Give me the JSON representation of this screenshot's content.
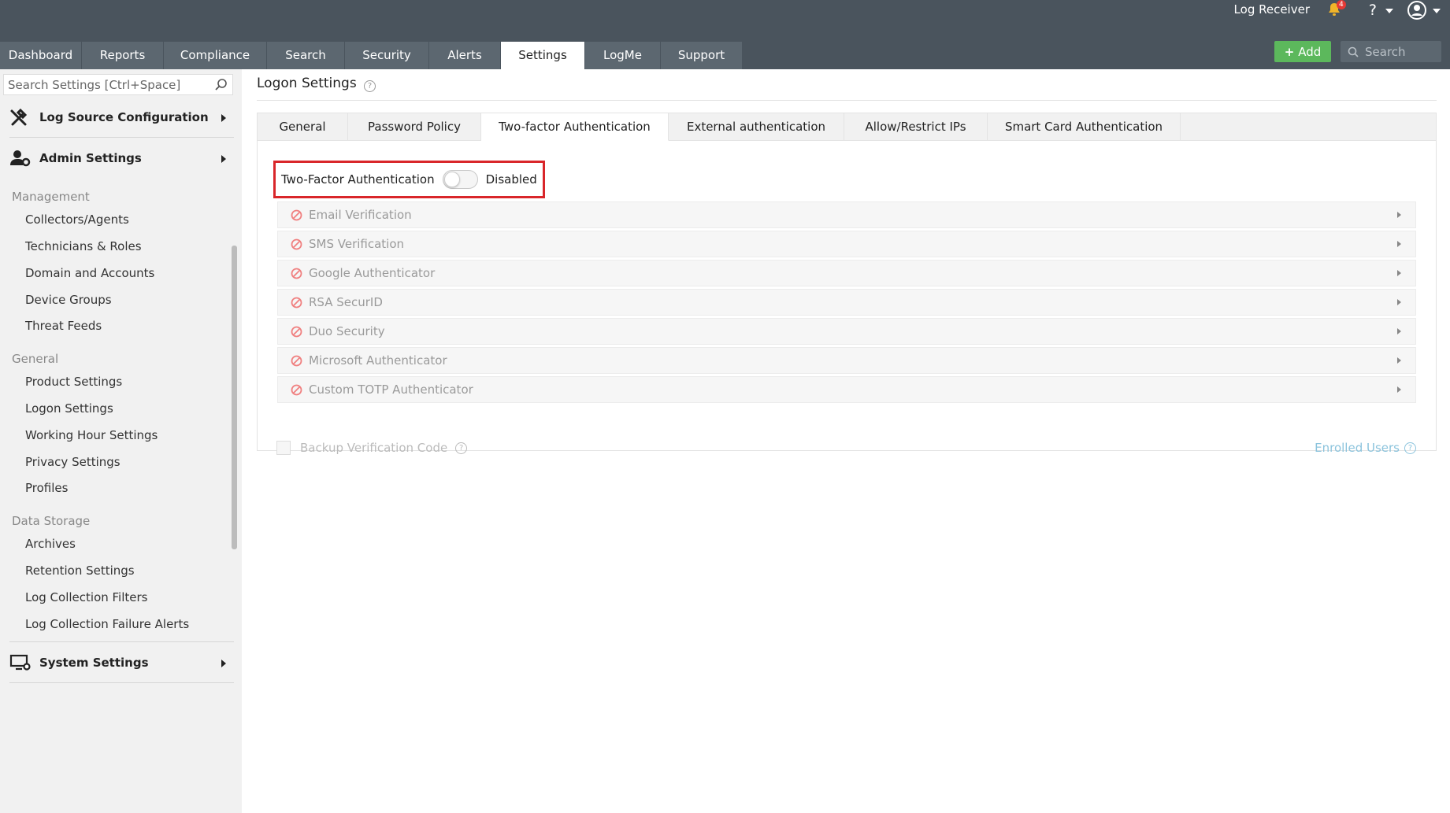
{
  "header": {
    "app_title": "Log Receiver",
    "notification_count": "4",
    "help_label": "?",
    "add_label": "Add",
    "search_placeholder": "Search"
  },
  "nav": {
    "tabs": [
      {
        "label": "Dashboard"
      },
      {
        "label": "Reports"
      },
      {
        "label": "Compliance"
      },
      {
        "label": "Search"
      },
      {
        "label": "Security"
      },
      {
        "label": "Alerts"
      },
      {
        "label": "Settings"
      },
      {
        "label": "LogMe"
      },
      {
        "label": "Support"
      }
    ],
    "active": "Settings"
  },
  "sidebar": {
    "search_placeholder": "Search Settings [Ctrl+Space]",
    "sections": {
      "log_source": "Log Source Configuration",
      "admin": "Admin Settings",
      "system": "System Settings"
    },
    "groups": [
      {
        "label": "Management",
        "items": [
          "Collectors/Agents",
          "Technicians & Roles",
          "Domain and Accounts",
          "Device Groups",
          "Threat Feeds"
        ]
      },
      {
        "label": "General",
        "items": [
          "Product Settings",
          "Logon Settings",
          "Working Hour Settings",
          "Privacy Settings",
          "Profiles"
        ]
      },
      {
        "label": "Data Storage",
        "items": [
          "Archives",
          "Retention Settings",
          "Log Collection Filters",
          "Log Collection Failure Alerts"
        ]
      }
    ]
  },
  "main": {
    "title": "Logon Settings",
    "tabs": [
      "General",
      "Password Policy",
      "Two-factor Authentication",
      "External authentication",
      "Allow/Restrict IPs",
      "Smart Card Authentication"
    ],
    "active_tab": "Two-factor Authentication",
    "tfa": {
      "label": "Two-Factor Authentication",
      "status": "Disabled",
      "enabled": false
    },
    "methods": [
      "Email Verification",
      "SMS Verification",
      "Google Authenticator",
      "RSA SecurID",
      "Duo Security",
      "Microsoft Authenticator",
      "Custom TOTP Authenticator"
    ],
    "backup_label": "Backup Verification Code",
    "enrolled_label": "Enrolled Users"
  },
  "colors": {
    "topbar": "#4a545d",
    "tab_bg": "#5c6770",
    "add_button": "#5cb85c",
    "highlight_border": "#d9262a",
    "disabled_icon": "#f08080"
  }
}
